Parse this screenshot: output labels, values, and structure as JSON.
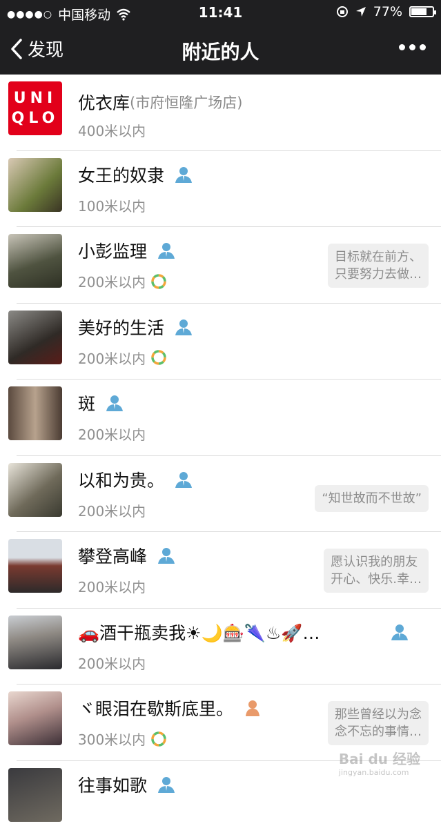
{
  "status_bar": {
    "carrier": "中国移动",
    "time": "11:41",
    "battery": "77%",
    "battery_level": 0.77
  },
  "nav": {
    "back_label": "发现",
    "title": "附近的人"
  },
  "people": [
    {
      "name": "优衣库",
      "sub": "(市府恒隆广场店)",
      "distance": "400米以内",
      "logo": [
        "UNI",
        "QLO"
      ]
    },
    {
      "name": "女王的奴隶",
      "gender": "male",
      "distance": "100米以内"
    },
    {
      "name": "小彭监理",
      "gender": "male",
      "distance": "200米以内",
      "moments": true,
      "signature": [
        "目标就在前方、",
        "只要努力去做…"
      ]
    },
    {
      "name": "美好的生活",
      "gender": "male",
      "distance": "200米以内",
      "moments": true
    },
    {
      "name": "斑",
      "gender": "male",
      "distance": "200米以内"
    },
    {
      "name": "以和为贵。",
      "gender": "male",
      "distance": "200米以内",
      "signature": [
        "“知世故而不世故”"
      ]
    },
    {
      "name": "攀登高峰",
      "gender": "male",
      "distance": "200米以内",
      "signature": [
        "愿认识我的朋友",
        "开心、快乐.幸…"
      ]
    },
    {
      "name": "🚗酒干瓶卖我☀🌙🎰🌂♨🚀…",
      "gender": "male",
      "distance": "200米以内"
    },
    {
      "name": "ヾ眼泪在歇斯底里。",
      "gender": "female",
      "distance": "300米以内",
      "moments": true,
      "signature": [
        "那些曾经以为念",
        "念不忘的事情…"
      ]
    },
    {
      "name": "往事如歌",
      "gender": "male",
      "distance": ""
    }
  ],
  "colors": {
    "header": "#1f1f21",
    "male_icon": "#5ea9d6",
    "female_icon": "#e99a6a",
    "uniqlo_red": "#e2001a"
  },
  "watermark": {
    "text": "Bai du 经验",
    "url": "jingyan.baidu.com"
  }
}
